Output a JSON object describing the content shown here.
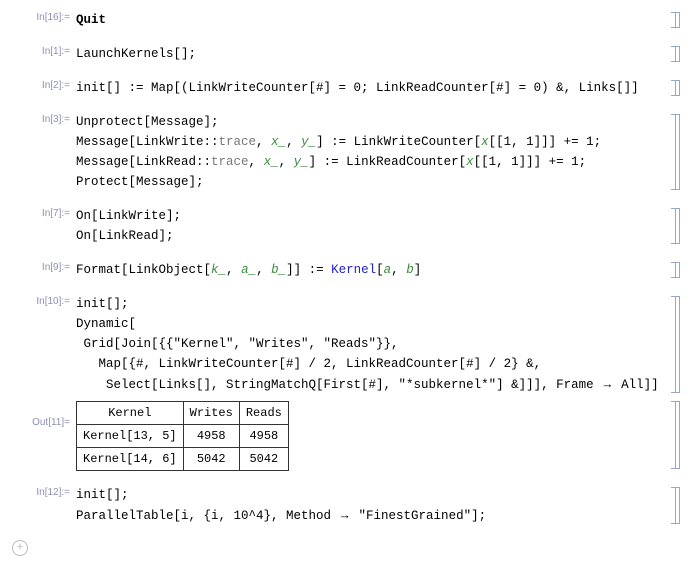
{
  "cells": {
    "c16": {
      "label": "In[16]:=",
      "code1": "Quit"
    },
    "c1": {
      "label": "In[1]:=",
      "code1": "LaunchKernels[];"
    },
    "c2": {
      "label": "In[2]:=",
      "code1": "init[] := Map[(LinkWriteCounter[#] = 0; LinkReadCounter[#] = 0) &, Links[]]"
    },
    "c3": {
      "label": "In[3]:=",
      "line1": "Unprotect[Message];",
      "line2a": "Message[LinkWrite::",
      "line2b": "trace",
      "line2c": ", ",
      "line2pat1": "x_",
      "line2d": ", ",
      "line2pat2": "y_",
      "line2e": "] := LinkWriteCounter[",
      "line2f": "x",
      "line2g": "[[1, 1]]] += 1;",
      "line3a": "Message[LinkRead::",
      "line3b": "trace",
      "line3c": ", ",
      "line3pat1": "x_",
      "line3d": ", ",
      "line3pat2": "y_",
      "line3e": "] := LinkReadCounter[",
      "line3f": "x",
      "line3g": "[[1, 1]]] += 1;",
      "line4": "Protect[Message];"
    },
    "c7": {
      "label": "In[7]:=",
      "line1": "On[LinkWrite];",
      "line2": "On[LinkRead];"
    },
    "c9": {
      "label": "In[9]:=",
      "a": "Format[LinkObject[",
      "p1": "k_",
      "c": ", ",
      "p2": "a_",
      "d": ", ",
      "p3": "b_",
      "e": "]] := ",
      "kern": "Kernel",
      "f": "[",
      "arg1": "a",
      "g": ", ",
      "arg2": "b",
      "h": "]"
    },
    "c10": {
      "label": "In[10]:=",
      "line1": "init[];",
      "line2": "Dynamic[",
      "line3": " Grid[Join[{{\"Kernel\", \"Writes\", \"Reads\"}},",
      "line4": "   Map[{#, LinkWriteCounter[#] / 2, LinkReadCounter[#] / 2} &,",
      "line5a": "    Select[Links[], StringMatchQ[First[#], \"*subkernel*\"] &]]], Frame ",
      "line5b": "→",
      "line5c": " All]]"
    },
    "out11": {
      "label": "Out[11]=",
      "headers": [
        "Kernel",
        "Writes",
        "Reads"
      ],
      "rows": [
        [
          "Kernel[13, 5]",
          "4958",
          "4958"
        ],
        [
          "Kernel[14, 6]",
          "5042",
          "5042"
        ]
      ]
    },
    "c12": {
      "label": "In[12]:=",
      "line1": "init[];",
      "line2a": "ParallelTable[i, {i, 10^4}, Method ",
      "line2b": "→",
      "line2c": " \"FinestGrained\"];"
    }
  },
  "icons": {
    "new_cell": "+"
  }
}
